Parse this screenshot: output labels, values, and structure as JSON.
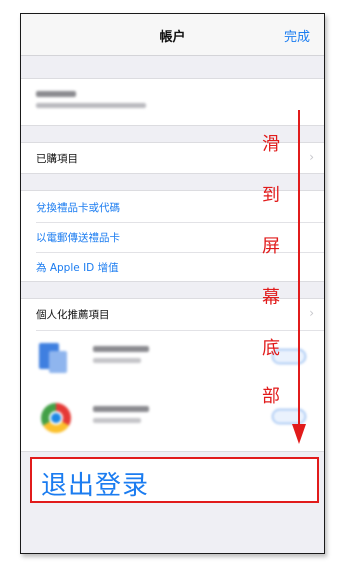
{
  "navbar": {
    "title": "帳户",
    "done_label": "完成"
  },
  "menu": {
    "purchased": "已購項目",
    "redeem": "兌換禮品卡或代碼",
    "send_gift": "以電郵傳送禮品卡",
    "add_funds": "為 Apple ID 增值",
    "personalized": "個人化推薦項目"
  },
  "annotation": {
    "scroll_hint_chars": [
      "滑",
      "到",
      "屏",
      "幕",
      "底",
      "部"
    ],
    "logout_label": "退出登录",
    "color": "#e11b1b"
  },
  "colors": {
    "link": "#1b7cf0",
    "background": "#efeff4"
  }
}
